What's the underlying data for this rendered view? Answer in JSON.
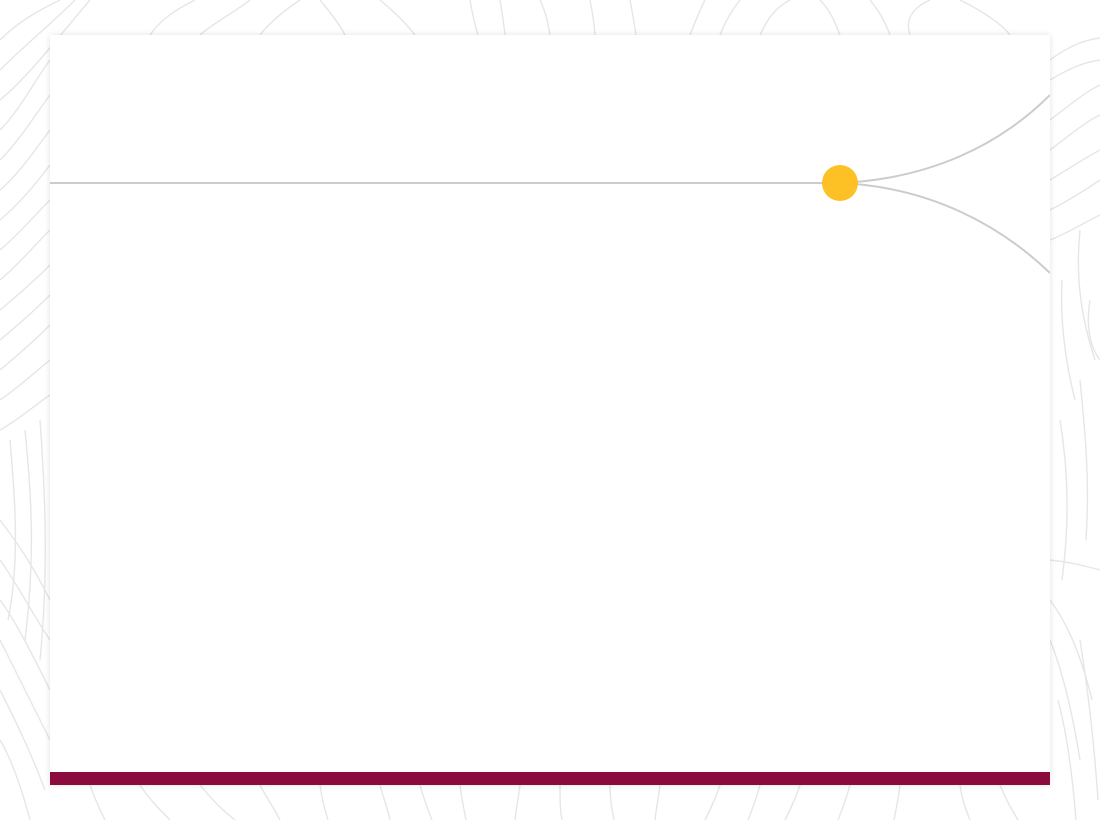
{
  "slide": {
    "title": "",
    "body": ""
  },
  "theme": {
    "page_background": "#ffffff",
    "slide_background": "#ffffff",
    "contour_color": "#e6e6e6",
    "connector_color": "#cccccc",
    "node_color": "#fdc125",
    "footer_bar_color": "#8c0b3e"
  },
  "decorations": {
    "background": "topographic-contour-pattern",
    "connector": "branching-line-with-node"
  }
}
